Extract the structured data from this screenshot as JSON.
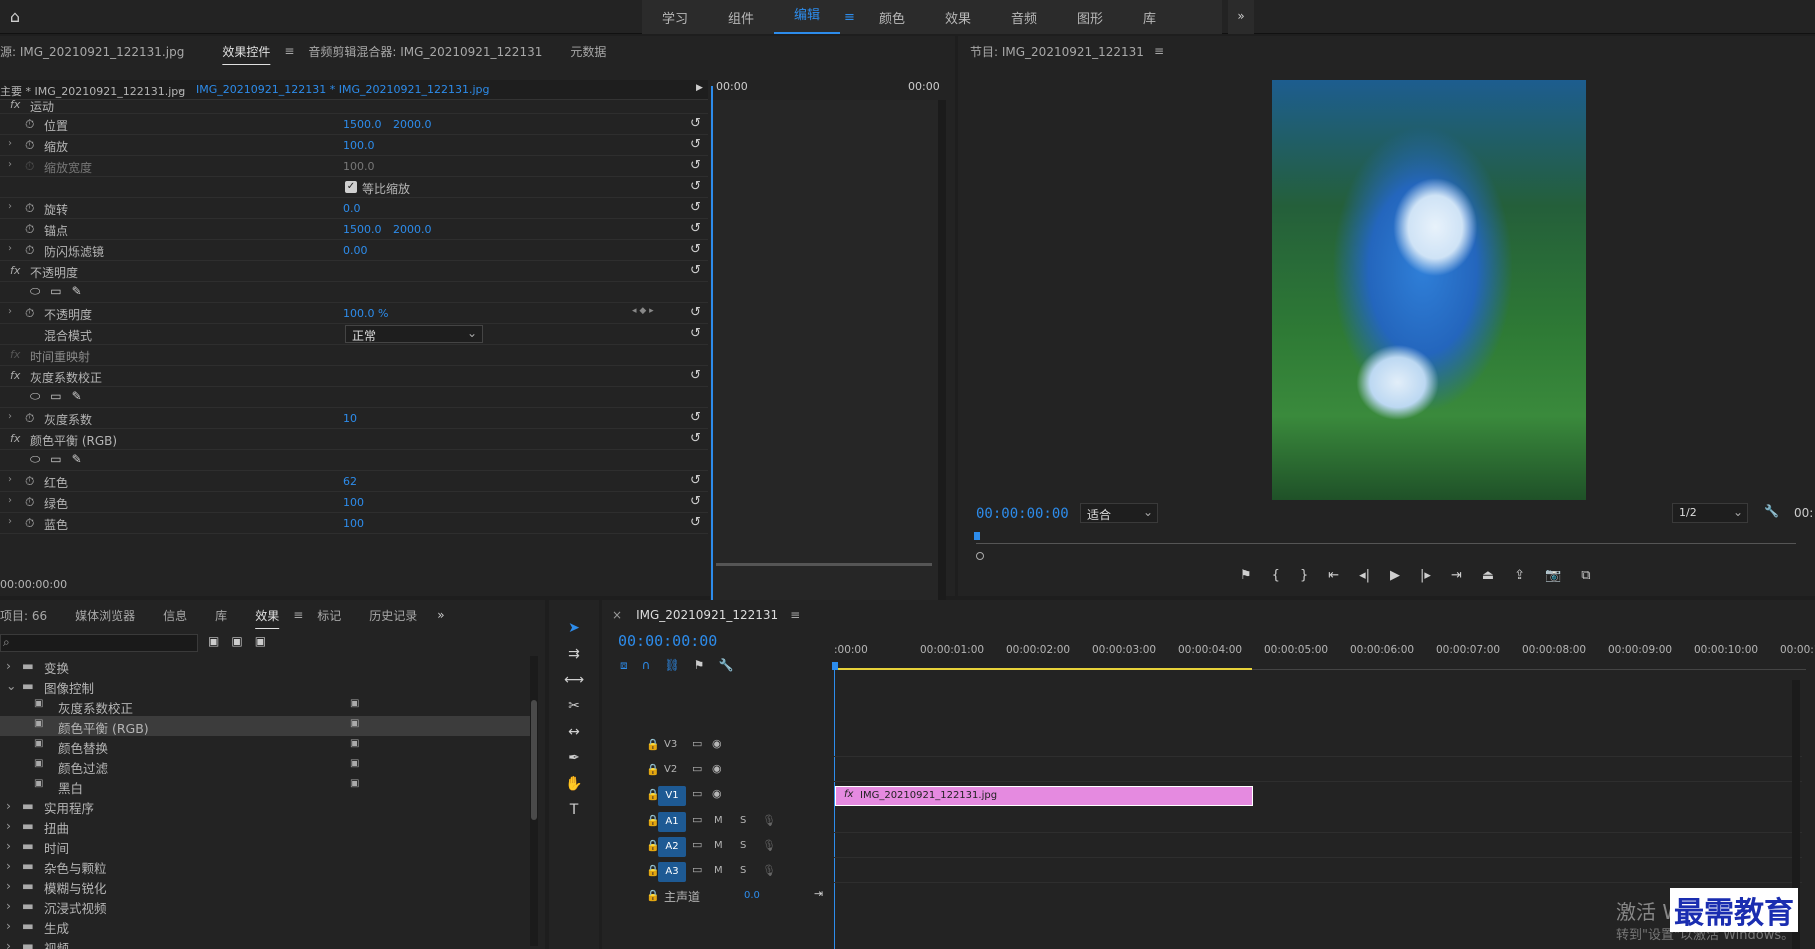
{
  "workspaces": {
    "items": [
      "学习",
      "组件",
      "编辑",
      "颜色",
      "效果",
      "音频",
      "图形",
      "库"
    ],
    "active": "编辑",
    "more": "»"
  },
  "effect_controls": {
    "source_tab": "源: IMG_20210921_122131.jpg",
    "tabs": [
      "效果控件",
      "音频剪辑混合器: IMG_20210921_122131",
      "元数据"
    ],
    "menu_icon": "≡",
    "master_clip": "主要 * IMG_20210921_122131.jpg",
    "sequence_clip": "IMG_20210921_122131 * IMG_20210921_122131.jpg",
    "time_start": "00:00",
    "time_end": "00:00",
    "section_motion": "运动",
    "rows": {
      "position": {
        "label": "位置",
        "v1": "1500.0",
        "v2": "2000.0"
      },
      "scale": {
        "label": "缩放",
        "v1": "100.0"
      },
      "scale_width": {
        "label": "缩放宽度",
        "v1": "100.0"
      },
      "uniform_scale": {
        "label": "等比缩放"
      },
      "rotation": {
        "label": "旋转",
        "v1": "0.0"
      },
      "anchor": {
        "label": "锚点",
        "v1": "1500.0",
        "v2": "2000.0"
      },
      "antiflicker": {
        "label": "防闪烁滤镜",
        "v1": "0.00"
      },
      "opacity_section": {
        "label": "不透明度"
      },
      "opacity": {
        "label": "不透明度",
        "v1": "100.0 %"
      },
      "blend_mode": {
        "label": "混合模式",
        "v1": "正常"
      },
      "time_remap": {
        "label": "时间重映射"
      },
      "gamma_section": {
        "label": "灰度系数校正"
      },
      "gamma": {
        "label": "灰度系数",
        "v1": "10"
      },
      "color_balance_section": {
        "label": "颜色平衡 (RGB)"
      },
      "red": {
        "label": "红色",
        "v1": "62"
      },
      "green": {
        "label": "绿色",
        "v1": "100"
      },
      "blue": {
        "label": "蓝色",
        "v1": "100"
      }
    },
    "timecode": "00:00:00:00"
  },
  "program": {
    "title": "节目: IMG_20210921_122131",
    "timecode": "00:00:00:00",
    "fit": "适合",
    "resolution": "1/2",
    "end_time": "00:"
  },
  "project": {
    "tabs": [
      "项目: 66",
      "媒体浏览器",
      "信息",
      "库",
      "效果",
      "标记",
      "历史记录"
    ],
    "active_tab": "效果",
    "tree": [
      {
        "label": "变换",
        "indent": 1
      },
      {
        "label": "图像控制",
        "indent": 1,
        "open": true
      },
      {
        "label": "灰度系数校正",
        "indent": 2
      },
      {
        "label": "颜色平衡 (RGB)",
        "indent": 2,
        "selected": true
      },
      {
        "label": "颜色替换",
        "indent": 2
      },
      {
        "label": "颜色过滤",
        "indent": 2
      },
      {
        "label": "黑白",
        "indent": 2
      },
      {
        "label": "实用程序",
        "indent": 1
      },
      {
        "label": "扭曲",
        "indent": 1
      },
      {
        "label": "时间",
        "indent": 1
      },
      {
        "label": "杂色与颗粒",
        "indent": 1
      },
      {
        "label": "模糊与锐化",
        "indent": 1
      },
      {
        "label": "沉浸式视频",
        "indent": 1
      },
      {
        "label": "生成",
        "indent": 1
      },
      {
        "label": "视频",
        "indent": 1
      }
    ]
  },
  "timeline": {
    "sequence": "IMG_20210921_122131",
    "timecode": "00:00:00:00",
    "ruler": [
      ":00:00",
      "00:00:01:00",
      "00:00:02:00",
      "00:00:03:00",
      "00:00:04:00",
      "00:00:05:00",
      "00:00:06:00",
      "00:00:07:00",
      "00:00:08:00",
      "00:00:09:00",
      "00:00:10:00",
      "00:00:1"
    ],
    "video_tracks": [
      "V3",
      "V2",
      "V1"
    ],
    "audio_tracks": [
      "A1",
      "A2",
      "A3"
    ],
    "mix_label": "主声道",
    "mix_value": "0.0",
    "clip_name": "IMG_20210921_122131.jpg",
    "clip_fx": "fx",
    "clip_color": "#e58ae0",
    "m": "M",
    "s": "S"
  },
  "watermark": {
    "line1": "激活 Win",
    "line2": "转到\"设置\"以激活 Windows。",
    "brand": "最需教育"
  }
}
